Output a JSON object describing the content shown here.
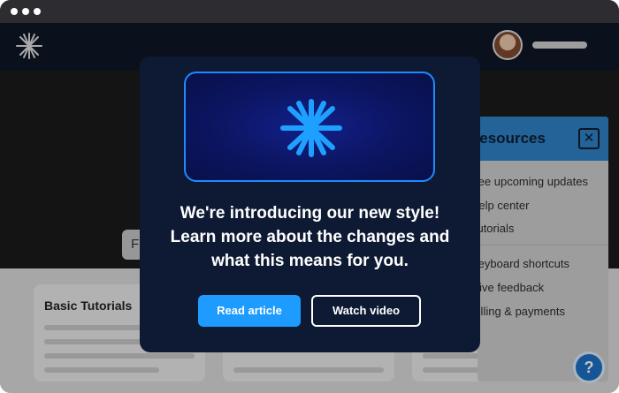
{
  "window": {
    "controls": [
      "dot",
      "dot",
      "dot"
    ]
  },
  "header": {
    "logo_icon": "asterisk-logo-icon",
    "avatar": "user-avatar"
  },
  "hero": {
    "search_stub_text": "F"
  },
  "cards": [
    {
      "title": "Basic Tutorials"
    },
    {
      "title": ""
    },
    {
      "title": ""
    }
  ],
  "resources_panel": {
    "title": "Resources",
    "close_icon": "close-icon",
    "items": [
      "See upcoming updates",
      "Help center",
      "Tutorials",
      "Keyboard shortcuts",
      "Give feedback",
      "Billing & payments"
    ]
  },
  "help_button": {
    "label": "?"
  },
  "modal": {
    "banner_icon": "asterisk-icon",
    "heading_line1": "We're introducing our new style!",
    "heading_line2": "Learn more about the changes and",
    "heading_line3": "what this means for you.",
    "primary_button": "Read article",
    "secondary_button": "Watch video"
  },
  "colors": {
    "modal_bg": "#0e1a33",
    "accent": "#1d9bff",
    "banner_border": "#1b8cff"
  }
}
